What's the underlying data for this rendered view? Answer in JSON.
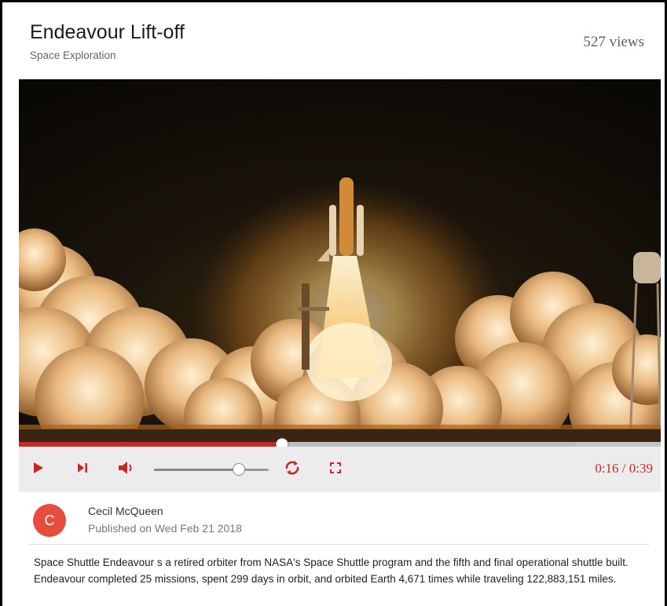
{
  "video": {
    "title": "Endeavour Lift-off",
    "category": "Space Exploration",
    "views": "527 views"
  },
  "player": {
    "progress": 0.41,
    "buffered": 0.866,
    "volume": 0.74,
    "time_display": "0:16 / 0:39",
    "icons": {
      "play": "play-icon",
      "next": "skip-next-icon",
      "volume": "volume-icon",
      "loop": "loop-icon",
      "fullscreen": "fullscreen-icon"
    },
    "colors": {
      "accent": "#c62828",
      "control_bg": "#ececec"
    }
  },
  "author": {
    "initial": "C",
    "name": "Cecil McQueen",
    "published": "Published on Wed Feb 21 2018",
    "avatar_color": "#e74c3c"
  },
  "description": "Space Shuttle Endeavour s a retired orbiter from NASA's Space Shuttle program and the fifth and final operational shuttle built. Endeavour completed 25 missions, spent 299 days in orbit, and orbited Earth 4,671 times while traveling 122,883,151 miles."
}
